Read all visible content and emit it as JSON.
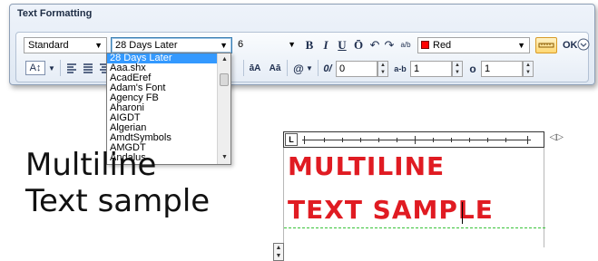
{
  "window": {
    "title": "Text Formatting"
  },
  "toolbar": {
    "style_select": "Standard",
    "font_select": "28 Days Later",
    "height_select": "6",
    "bold_label": "B",
    "italic_label": "I",
    "underline_label": "U",
    "overline_label": "Ō",
    "undo_icon": "↶",
    "redo_icon": "↷",
    "stack_label": "a/b",
    "color_label": "Red",
    "color_hex": "#ff0000",
    "ok_label": "OK",
    "options_icon": "chevron-circle-down-icon",
    "row2": {
      "justify_icon": "A↕",
      "oblique_label": "0/",
      "oblique_value": "0",
      "tracking_label": "a-b",
      "tracking_value": "1",
      "width_label": "o",
      "width_value": "1",
      "upper_label": "āA",
      "lower_label": "Aā",
      "symbol_label": "@"
    }
  },
  "font_list": {
    "items": [
      "28 Days Later",
      "Aaa.shx",
      "AcadEref",
      "Adam's Font",
      "Agency FB",
      "Aharoni",
      "AIGDT",
      "Algerian",
      "AmdtSymbols",
      "AMGDT",
      "Andalus"
    ],
    "selected_index": 0
  },
  "sample": {
    "left_line1": "Multiline",
    "left_line2": "Text sample",
    "right_line1": "MULTILINE",
    "right_line2": "TEXT SAMPLE"
  },
  "ruler": {
    "indent_label": "L",
    "arrows": "◁▷"
  },
  "colors": {
    "accent": "#3399ff",
    "text_red": "#e01b22",
    "baseline_green": "#39c339"
  }
}
